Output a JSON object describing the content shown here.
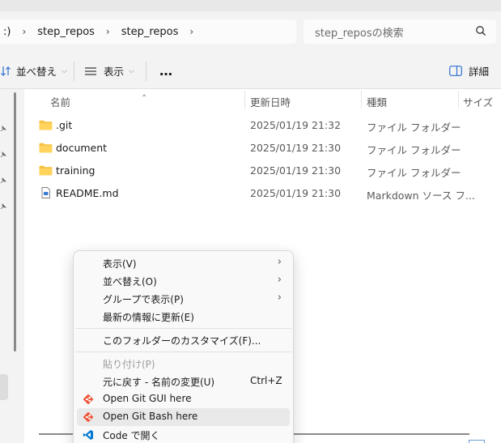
{
  "address": {
    "breadcrumbs": [
      ":)",
      "step_repos",
      "step_repos"
    ]
  },
  "search": {
    "placeholder": "step_reposの検索"
  },
  "toolbar": {
    "sort_label": "並べ替え",
    "view_label": "表示",
    "more_label": "…",
    "details_label": "詳細"
  },
  "columns": {
    "name": "名前",
    "date": "更新日時",
    "type": "種類",
    "size": "サイズ"
  },
  "files": [
    {
      "name": ".git",
      "date": "2025/01/19 21:32",
      "type": "ファイル フォルダー",
      "icon": "folder-icon"
    },
    {
      "name": "document",
      "date": "2025/01/19 21:30",
      "type": "ファイル フォルダー",
      "icon": "folder-icon"
    },
    {
      "name": "training",
      "date": "2025/01/19 21:30",
      "type": "ファイル フォルダー",
      "icon": "folder-icon"
    },
    {
      "name": "README.md",
      "date": "2025/01/19 21:30",
      "type": "Markdown ソース フ...",
      "icon": "markdown-file-icon"
    }
  ],
  "context_menu": {
    "view": "表示(V)",
    "sort": "並べ替え(O)",
    "group": "グループで表示(P)",
    "refresh": "最新の情報に更新(E)",
    "customize": "このフォルダーのカスタマイズ(F)...",
    "paste": "貼り付け(P)",
    "undo": "元に戻す - 名前の変更(U)",
    "undo_shortcut": "Ctrl+Z",
    "git_gui": "Open Git GUI here",
    "git_bash": "Open Git Bash here",
    "vscode": "Code で開く"
  },
  "colors": {
    "folder": "#f5c242",
    "accent": "#0067c0",
    "vscode": "#0078d4"
  }
}
